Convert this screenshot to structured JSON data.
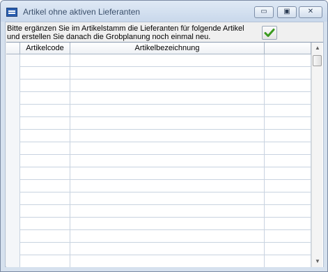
{
  "window": {
    "title": "Artikel ohne aktiven Lieferanten",
    "icon": "table-window-icon",
    "controls": {
      "minimize": "▭",
      "maximize": "▣",
      "close": "✕"
    }
  },
  "message": {
    "line1": "Bitte ergänzen Sie im Artikelstamm die Lieferanten für folgende Artikel",
    "line2": "und erstellen Sie danach die Grobplanung noch einmal neu."
  },
  "ok_button": {
    "icon": "green-checkmark-icon",
    "color": "#3a9a1e"
  },
  "grid": {
    "columns": [
      "",
      "Artikelcode",
      "Artikelbezeichnung",
      ""
    ],
    "rows": [
      [
        "",
        "",
        ""
      ],
      [
        "",
        "",
        ""
      ],
      [
        "",
        "",
        ""
      ],
      [
        "",
        "",
        ""
      ],
      [
        "",
        "",
        ""
      ],
      [
        "",
        "",
        ""
      ],
      [
        "",
        "",
        ""
      ],
      [
        "",
        "",
        ""
      ],
      [
        "",
        "",
        ""
      ],
      [
        "",
        "",
        ""
      ],
      [
        "",
        "",
        ""
      ],
      [
        "",
        "",
        ""
      ],
      [
        "",
        "",
        ""
      ],
      [
        "",
        "",
        ""
      ],
      [
        "",
        "",
        ""
      ],
      [
        "",
        "",
        ""
      ],
      [
        "",
        "",
        ""
      ],
      [
        "",
        "",
        ""
      ]
    ]
  },
  "scrollbar": {
    "up": "▲",
    "down": "▼"
  }
}
